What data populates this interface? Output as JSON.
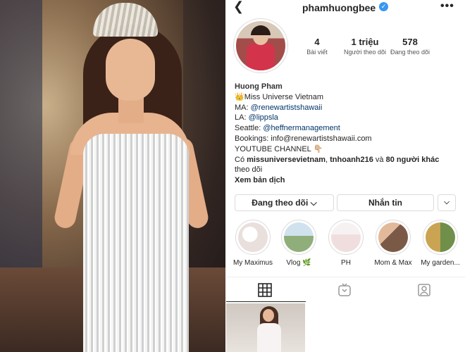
{
  "profile": {
    "username": "phamhuongbee",
    "verified_icon": "verified-badge-icon"
  },
  "stats": {
    "posts_count": "4",
    "posts_label": "Bài viết",
    "followers_count": "1 triệu",
    "followers_label": "Người theo dõi",
    "following_count": "578",
    "following_label": "Đang theo dõi"
  },
  "bio": {
    "name": "Huong Pham",
    "line1_emoji": "👑",
    "line1_text": "Miss Universe Vietnam",
    "ma_prefix": "MA: ",
    "ma_link": "@renewartistshawaii",
    "la_prefix": "LA: ",
    "la_link": "@lippsla",
    "seattle_prefix": "Seattle: ",
    "seattle_link": "@heffnermanagement",
    "bookings_prefix": "Bookings:  ",
    "bookings_email": "info@renewartistshawaii.com",
    "youtube": "YOUTUBE CHANNEL",
    "youtube_emoji": "👇🏼",
    "followed_prefix": "Có ",
    "followed_user1": "missuniversevietnam",
    "followed_sep": ", ",
    "followed_user2": "tnhoanh216",
    "followed_mid": " và ",
    "followed_others": "80 người khác",
    "followed_suffix": "theo dõi",
    "translate": "Xem bản dịch"
  },
  "buttons": {
    "following_label": "Đang theo dõi",
    "message_label": "Nhắn tin"
  },
  "highlights": [
    {
      "label": "My Maximus",
      "color": "#e9dfdc"
    },
    {
      "label": "Vlog 🌿",
      "color": "#8fae7a"
    },
    {
      "label": "PH",
      "color": "#f0dede"
    },
    {
      "label": "Mom & Max",
      "color": "#7a5a47"
    },
    {
      "label": "My garden...",
      "color": "#caa453"
    }
  ],
  "tabs": [
    "grid-icon",
    "igtv-icon",
    "tagged-icon"
  ],
  "colors": {
    "link": "#003569",
    "verified": "#3897f0",
    "border": "#dbdbdb"
  }
}
